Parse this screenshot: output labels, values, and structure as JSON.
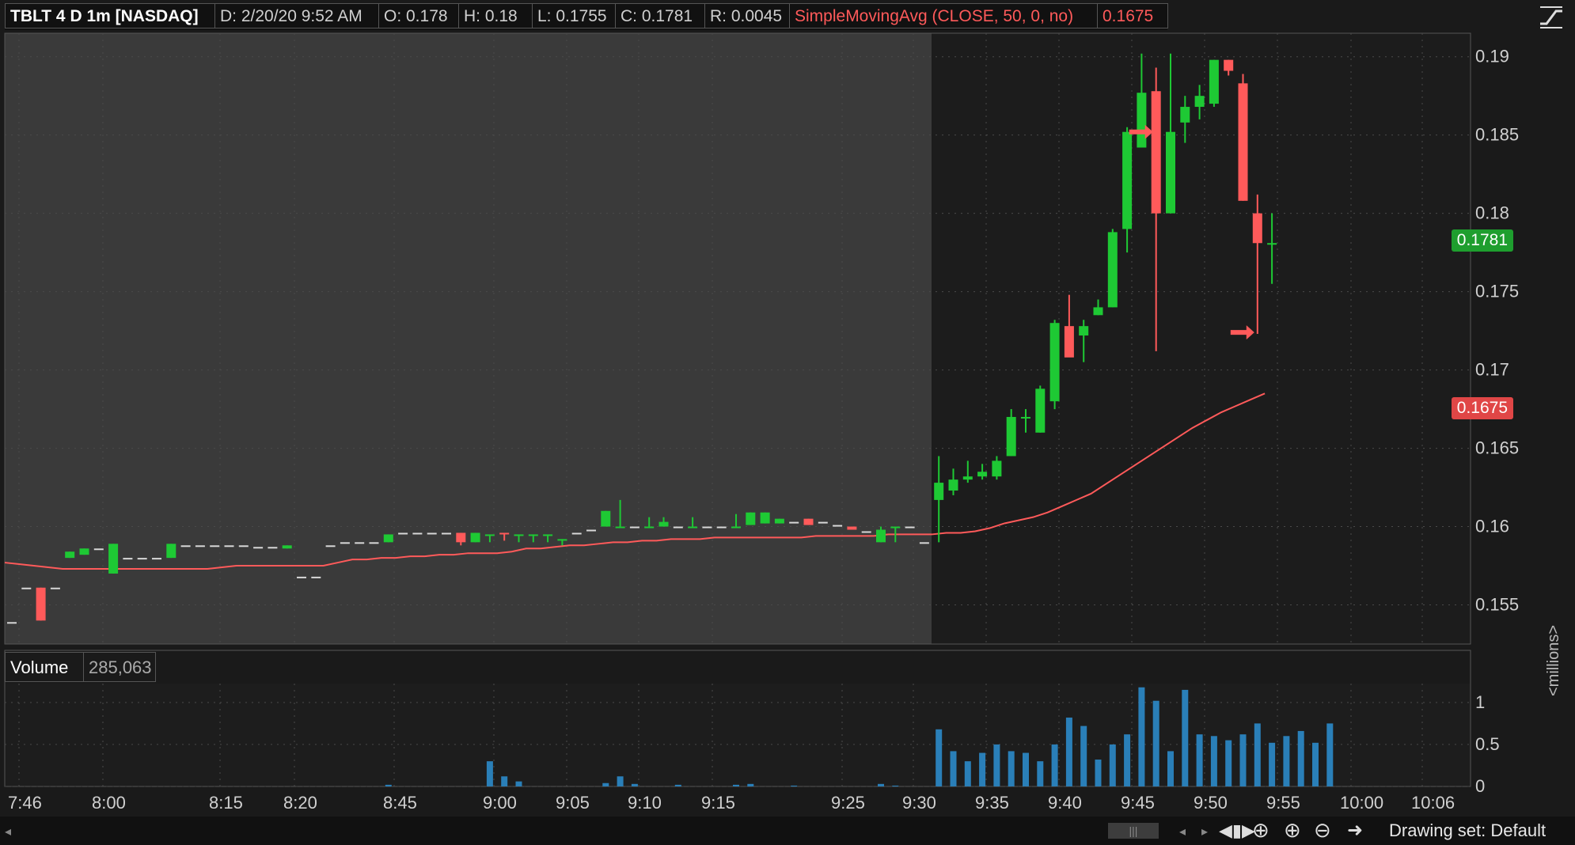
{
  "header": {
    "symbol": "TBLT 4 D 1m [NASDAQ]",
    "date": "D: 2/20/20 9:52 AM",
    "open": "O: 0.178",
    "high": "H: 0.18",
    "low": "L: 0.1755",
    "close": "C: 0.1781",
    "range": "R: 0.0045",
    "study": "SimpleMovingAvg (CLOSE, 50, 0, no)",
    "study_value": "0.1675"
  },
  "price_tags": {
    "last": "0.1781",
    "sma": "0.1675"
  },
  "volume": {
    "label": "Volume",
    "value": "285,063",
    "unit_label": "<millions>"
  },
  "colors": {
    "up": "#1ec934",
    "down": "#ff5a5a",
    "sma": "#ff5a5a",
    "volume": "#2a7fb8",
    "premarket_bg": "#3a3a3a",
    "market_bg": "#1c1c1c",
    "grid": "#4a4a4a"
  },
  "bottom_toolbar": {
    "drawing_set": "Drawing set: Default"
  },
  "icons": [
    "style-icon",
    "scroll-left-icon",
    "scroll-right-icon",
    "expand-icon",
    "crosshair-icon",
    "zoom-in-icon",
    "zoom-out-icon",
    "arrow-right-icon"
  ],
  "chart_data": {
    "type": "candlestick",
    "price_axis": {
      "ticks": [
        0.19,
        0.185,
        0.18,
        0.175,
        0.17,
        0.165,
        0.16,
        0.155
      ],
      "ylim": [
        0.1525,
        0.1915
      ]
    },
    "time_axis": {
      "ticks": [
        "7:46",
        "8:00",
        "8:15",
        "8:20",
        "8:45",
        "9:00",
        "9:05",
        "9:10",
        "9:15",
        "9:25",
        "9:30",
        "9:35",
        "9:40",
        "9:45",
        "9:50",
        "9:55",
        "10:00",
        "10:06"
      ]
    },
    "volume_axis": {
      "ticks": [
        1,
        0.5,
        0
      ],
      "ylim": [
        0,
        1.2
      ]
    },
    "candles": [
      {
        "t": 0,
        "o": 0.1539,
        "h": 0.1539,
        "l": 0.1539,
        "c": 0.1539
      },
      {
        "t": 1,
        "o": 0.1561,
        "h": 0.1561,
        "l": 0.1561,
        "c": 0.1561
      },
      {
        "t": 2,
        "o": 0.1561,
        "h": 0.1561,
        "l": 0.154,
        "c": 0.154
      },
      {
        "t": 3,
        "o": 0.1561,
        "h": 0.1561,
        "l": 0.1561,
        "c": 0.1561
      },
      {
        "t": 4,
        "o": 0.158,
        "h": 0.1584,
        "l": 0.158,
        "c": 0.1584
      },
      {
        "t": 5,
        "o": 0.1582,
        "h": 0.1586,
        "l": 0.1582,
        "c": 0.1586
      },
      {
        "t": 6,
        "o": 0.1586,
        "h": 0.1586,
        "l": 0.1586,
        "c": 0.1586
      },
      {
        "t": 7,
        "o": 0.157,
        "h": 0.1589,
        "l": 0.157,
        "c": 0.1589
      },
      {
        "t": 8,
        "o": 0.158,
        "h": 0.158,
        "l": 0.158,
        "c": 0.158
      },
      {
        "t": 9,
        "o": 0.158,
        "h": 0.158,
        "l": 0.158,
        "c": 0.158
      },
      {
        "t": 10,
        "o": 0.158,
        "h": 0.158,
        "l": 0.158,
        "c": 0.158
      },
      {
        "t": 11,
        "o": 0.158,
        "h": 0.1589,
        "l": 0.158,
        "c": 0.1589
      },
      {
        "t": 12,
        "o": 0.1588,
        "h": 0.1588,
        "l": 0.1588,
        "c": 0.1588
      },
      {
        "t": 13,
        "o": 0.1588,
        "h": 0.1588,
        "l": 0.1588,
        "c": 0.1588
      },
      {
        "t": 14,
        "o": 0.1588,
        "h": 0.1588,
        "l": 0.1588,
        "c": 0.1588
      },
      {
        "t": 15,
        "o": 0.1588,
        "h": 0.1588,
        "l": 0.1588,
        "c": 0.1588
      },
      {
        "t": 16,
        "o": 0.1588,
        "h": 0.1588,
        "l": 0.1588,
        "c": 0.1588
      },
      {
        "t": 17,
        "o": 0.1587,
        "h": 0.1587,
        "l": 0.1587,
        "c": 0.1587
      },
      {
        "t": 18,
        "o": 0.1587,
        "h": 0.1587,
        "l": 0.1587,
        "c": 0.1587
      },
      {
        "t": 19,
        "o": 0.1586,
        "h": 0.1588,
        "l": 0.1586,
        "c": 0.1588
      },
      {
        "t": 20,
        "o": 0.1568,
        "h": 0.1568,
        "l": 0.1568,
        "c": 0.1568
      },
      {
        "t": 21,
        "o": 0.1568,
        "h": 0.1568,
        "l": 0.1568,
        "c": 0.1568
      },
      {
        "t": 22,
        "o": 0.1588,
        "h": 0.1588,
        "l": 0.1588,
        "c": 0.1588
      },
      {
        "t": 23,
        "o": 0.159,
        "h": 0.159,
        "l": 0.159,
        "c": 0.159
      },
      {
        "t": 24,
        "o": 0.159,
        "h": 0.159,
        "l": 0.159,
        "c": 0.159
      },
      {
        "t": 25,
        "o": 0.159,
        "h": 0.159,
        "l": 0.159,
        "c": 0.159
      },
      {
        "t": 26,
        "o": 0.159,
        "h": 0.1595,
        "l": 0.159,
        "c": 0.1595
      },
      {
        "t": 27,
        "o": 0.1596,
        "h": 0.1596,
        "l": 0.1596,
        "c": 0.1596
      },
      {
        "t": 28,
        "o": 0.1596,
        "h": 0.1596,
        "l": 0.1596,
        "c": 0.1596
      },
      {
        "t": 29,
        "o": 0.1596,
        "h": 0.1596,
        "l": 0.1596,
        "c": 0.1596
      },
      {
        "t": 30,
        "o": 0.1596,
        "h": 0.1596,
        "l": 0.1596,
        "c": 0.1596
      },
      {
        "t": 31,
        "o": 0.1596,
        "h": 0.1596,
        "l": 0.1588,
        "c": 0.159
      },
      {
        "t": 32,
        "o": 0.159,
        "h": 0.1596,
        "l": 0.159,
        "c": 0.1596
      },
      {
        "t": 33,
        "o": 0.1595,
        "h": 0.1595,
        "l": 0.159,
        "c": 0.1595
      },
      {
        "t": 34,
        "o": 0.1596,
        "h": 0.1596,
        "l": 0.1591,
        "c": 0.1595
      },
      {
        "t": 35,
        "o": 0.1595,
        "h": 0.1595,
        "l": 0.159,
        "c": 0.1595
      },
      {
        "t": 36,
        "o": 0.1595,
        "h": 0.1595,
        "l": 0.159,
        "c": 0.1595
      },
      {
        "t": 37,
        "o": 0.1595,
        "h": 0.1595,
        "l": 0.159,
        "c": 0.1595
      },
      {
        "t": 38,
        "o": 0.1592,
        "h": 0.1592,
        "l": 0.1588,
        "c": 0.1592
      },
      {
        "t": 39,
        "o": 0.1596,
        "h": 0.1596,
        "l": 0.1596,
        "c": 0.1596
      },
      {
        "t": 40,
        "o": 0.1598,
        "h": 0.1598,
        "l": 0.1598,
        "c": 0.1598
      },
      {
        "t": 41,
        "o": 0.16,
        "h": 0.161,
        "l": 0.16,
        "c": 0.161
      },
      {
        "t": 42,
        "o": 0.16,
        "h": 0.1617,
        "l": 0.16,
        "c": 0.16
      },
      {
        "t": 43,
        "o": 0.16,
        "h": 0.16,
        "l": 0.16,
        "c": 0.16
      },
      {
        "t": 44,
        "o": 0.16,
        "h": 0.1606,
        "l": 0.16,
        "c": 0.16
      },
      {
        "t": 45,
        "o": 0.16,
        "h": 0.1606,
        "l": 0.16,
        "c": 0.1603
      },
      {
        "t": 46,
        "o": 0.16,
        "h": 0.16,
        "l": 0.16,
        "c": 0.16
      },
      {
        "t": 47,
        "o": 0.16,
        "h": 0.1606,
        "l": 0.16,
        "c": 0.16
      },
      {
        "t": 48,
        "o": 0.16,
        "h": 0.16,
        "l": 0.16,
        "c": 0.16
      },
      {
        "t": 49,
        "o": 0.16,
        "h": 0.16,
        "l": 0.16,
        "c": 0.16
      },
      {
        "t": 50,
        "o": 0.16,
        "h": 0.1608,
        "l": 0.16,
        "c": 0.16
      },
      {
        "t": 51,
        "o": 0.1601,
        "h": 0.1609,
        "l": 0.1601,
        "c": 0.1609
      },
      {
        "t": 52,
        "o": 0.1602,
        "h": 0.1609,
        "l": 0.1602,
        "c": 0.1609
      },
      {
        "t": 53,
        "o": 0.1602,
        "h": 0.1605,
        "l": 0.1602,
        "c": 0.1605
      },
      {
        "t": 54,
        "o": 0.1603,
        "h": 0.1603,
        "l": 0.1603,
        "c": 0.1603
      },
      {
        "t": 55,
        "o": 0.1605,
        "h": 0.1605,
        "l": 0.1601,
        "c": 0.1601
      },
      {
        "t": 56,
        "o": 0.1603,
        "h": 0.1603,
        "l": 0.1603,
        "c": 0.1603
      },
      {
        "t": 57,
        "o": 0.1601,
        "h": 0.1601,
        "l": 0.1601,
        "c": 0.1601
      },
      {
        "t": 58,
        "o": 0.16,
        "h": 0.16,
        "l": 0.1598,
        "c": 0.1598
      },
      {
        "t": 59,
        "o": 0.1597,
        "h": 0.1597,
        "l": 0.1597,
        "c": 0.1597
      },
      {
        "t": 60,
        "o": 0.159,
        "h": 0.16,
        "l": 0.159,
        "c": 0.1598
      },
      {
        "t": 61,
        "o": 0.16,
        "h": 0.16,
        "l": 0.159,
        "c": 0.16
      },
      {
        "t": 62,
        "o": 0.16,
        "h": 0.16,
        "l": 0.16,
        "c": 0.16
      },
      {
        "t": 63,
        "o": 0.159,
        "h": 0.159,
        "l": 0.159,
        "c": 0.159
      },
      {
        "t": 64,
        "o": 0.1617,
        "h": 0.1645,
        "l": 0.159,
        "c": 0.1628
      },
      {
        "t": 65,
        "o": 0.1623,
        "h": 0.1637,
        "l": 0.162,
        "c": 0.163
      },
      {
        "t": 66,
        "o": 0.163,
        "h": 0.1642,
        "l": 0.1628,
        "c": 0.1632
      },
      {
        "t": 67,
        "o": 0.1632,
        "h": 0.164,
        "l": 0.163,
        "c": 0.1635
      },
      {
        "t": 68,
        "o": 0.1632,
        "h": 0.1645,
        "l": 0.163,
        "c": 0.1642
      },
      {
        "t": 69,
        "o": 0.1645,
        "h": 0.1675,
        "l": 0.1645,
        "c": 0.167
      },
      {
        "t": 70,
        "o": 0.167,
        "h": 0.1675,
        "l": 0.166,
        "c": 0.167
      },
      {
        "t": 71,
        "o": 0.166,
        "h": 0.169,
        "l": 0.166,
        "c": 0.1688
      },
      {
        "t": 72,
        "o": 0.168,
        "h": 0.1732,
        "l": 0.1675,
        "c": 0.173
      },
      {
        "t": 73,
        "o": 0.1728,
        "h": 0.1748,
        "l": 0.171,
        "c": 0.1708
      },
      {
        "t": 74,
        "o": 0.1722,
        "h": 0.1732,
        "l": 0.1705,
        "c": 0.1728
      },
      {
        "t": 75,
        "o": 0.1735,
        "h": 0.1745,
        "l": 0.1735,
        "c": 0.174
      },
      {
        "t": 76,
        "o": 0.174,
        "h": 0.179,
        "l": 0.174,
        "c": 0.1788
      },
      {
        "t": 77,
        "o": 0.179,
        "h": 0.1855,
        "l": 0.1775,
        "c": 0.1852
      },
      {
        "t": 78,
        "o": 0.1842,
        "h": 0.1902,
        "l": 0.1842,
        "c": 0.1877
      },
      {
        "t": 79,
        "o": 0.1878,
        "h": 0.1893,
        "l": 0.1712,
        "c": 0.18
      },
      {
        "t": 80,
        "o": 0.18,
        "h": 0.1902,
        "l": 0.18,
        "c": 0.1852
      },
      {
        "t": 81,
        "o": 0.1858,
        "h": 0.1875,
        "l": 0.1845,
        "c": 0.1868
      },
      {
        "t": 82,
        "o": 0.1868,
        "h": 0.1882,
        "l": 0.186,
        "c": 0.1875
      },
      {
        "t": 83,
        "o": 0.187,
        "h": 0.1898,
        "l": 0.1868,
        "c": 0.1898
      },
      {
        "t": 84,
        "o": 0.1898,
        "h": 0.1898,
        "l": 0.1888,
        "c": 0.1891
      },
      {
        "t": 85,
        "o": 0.1883,
        "h": 0.1889,
        "l": 0.1808,
        "c": 0.1808
      },
      {
        "t": 86,
        "o": 0.18,
        "h": 0.1812,
        "l": 0.1723,
        "c": 0.1781
      },
      {
        "t": 87,
        "o": 0.178,
        "h": 0.18,
        "l": 0.1755,
        "c": 0.1781
      }
    ],
    "sma": [
      0.1577,
      0.1576,
      0.1575,
      0.1574,
      0.1573,
      0.1573,
      0.1573,
      0.1573,
      0.1573,
      0.1573,
      0.1573,
      0.1573,
      0.1573,
      0.1573,
      0.1573,
      0.1574,
      0.1575,
      0.1575,
      0.1575,
      0.1575,
      0.1575,
      0.1575,
      0.1575,
      0.1577,
      0.1579,
      0.1579,
      0.158,
      0.158,
      0.1581,
      0.1581,
      0.1582,
      0.1582,
      0.1583,
      0.1583,
      0.1583,
      0.1584,
      0.1586,
      0.1586,
      0.1587,
      0.1588,
      0.1588,
      0.1589,
      0.159,
      0.159,
      0.1591,
      0.1591,
      0.1592,
      0.1592,
      0.1592,
      0.1593,
      0.1593,
      0.1593,
      0.1593,
      0.1593,
      0.1593,
      0.1593,
      0.1594,
      0.1594,
      0.1594,
      0.1594,
      0.1594,
      0.1595,
      0.1595,
      0.1595,
      0.1595,
      0.1596,
      0.1596,
      0.1597,
      0.1599,
      0.1602,
      0.1604,
      0.1606,
      0.1609,
      0.1613,
      0.1617,
      0.1621,
      0.1627,
      0.1633,
      0.1639,
      0.1645,
      0.1651,
      0.1657,
      0.1663,
      0.1668,
      0.1673,
      0.1677,
      0.1681,
      0.1685
    ],
    "volume_values": [
      0,
      0,
      0,
      0,
      0,
      0,
      0,
      0,
      0,
      0,
      0,
      0,
      0,
      0,
      0,
      0,
      0,
      0,
      0,
      0,
      0,
      0,
      0,
      0,
      0,
      0,
      0.02,
      0,
      0,
      0,
      0,
      0,
      0,
      0.3,
      0.12,
      0.06,
      0,
      0,
      0,
      0,
      0,
      0.04,
      0.12,
      0.03,
      0,
      0,
      0.02,
      0,
      0,
      0,
      0.02,
      0.03,
      0,
      0,
      0.01,
      0,
      0,
      0,
      0,
      0,
      0.03,
      0.01,
      0,
      0,
      0.68,
      0.42,
      0.3,
      0.4,
      0.5,
      0.42,
      0.4,
      0.3,
      0.5,
      0.82,
      0.72,
      0.32,
      0.5,
      0.62,
      1.18,
      1.02,
      0.42,
      1.15,
      0.62,
      0.6,
      0.55,
      0.62,
      0.75,
      0.52,
      0.6,
      0.66,
      0.52,
      0.75
    ],
    "session_split_index": 64,
    "annotations": [
      {
        "type": "arrow",
        "direction": "right",
        "x_index": 79,
        "y": 0.1852
      },
      {
        "type": "arrow",
        "direction": "right",
        "x_index": 86,
        "y": 0.1724
      }
    ]
  }
}
